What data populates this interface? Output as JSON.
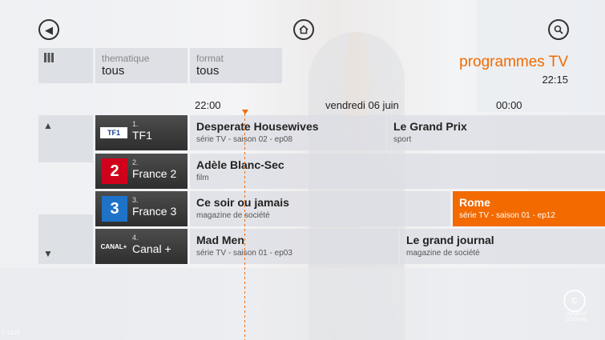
{
  "nav": {
    "back_icon": "back-arrow-icon",
    "home_icon": "home-icon",
    "search_icon": "search-icon"
  },
  "filters": [
    {
      "label": "thematique",
      "value": "tous"
    },
    {
      "label": "format",
      "value": "tous"
    }
  ],
  "header": {
    "title": "programmes TV",
    "clock": "22:15"
  },
  "timeline": {
    "start": "22:00",
    "date": "vendredi 06 juin",
    "end": "00:00"
  },
  "channels": [
    {
      "number": "1.",
      "name": "TF1",
      "logo": "TF1"
    },
    {
      "number": "2.",
      "name": "France 2",
      "logo": "2"
    },
    {
      "number": "3.",
      "name": "France 3",
      "logo": "3"
    },
    {
      "number": "4.",
      "name": "Canal +",
      "logo": "CANAL+"
    }
  ],
  "programs": [
    [
      {
        "title": "Desperate Housewives",
        "subtitle": "série TV - saison 02 - ep08"
      },
      {
        "title": "Le Grand Prix",
        "subtitle": "sport"
      }
    ],
    [
      {
        "title": "Adèle Blanc-Sec",
        "subtitle": "film"
      }
    ],
    [
      {
        "title": "Ce soir ou jamais",
        "subtitle": "magazine de société"
      },
      {
        "title": "Rome",
        "subtitle": "série TV - saison 01 - ep12"
      }
    ],
    [
      {
        "title": "Mad Men",
        "subtitle": "série TV - saison 01 - ep03"
      },
      {
        "title": "Le grand journal",
        "subtitle": "magazine de société"
      }
    ]
  ],
  "colors": {
    "accent": "#f26a00"
  },
  "corner": {
    "cc_logo": "C",
    "cc_text": "COMEDY CENTRAL",
    "watermark": "© OLIB"
  }
}
